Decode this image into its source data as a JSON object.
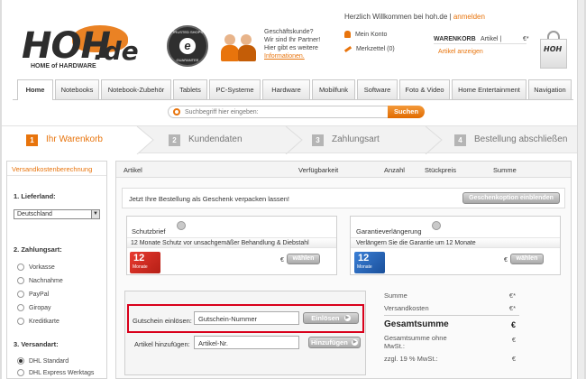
{
  "colors": {
    "accent": "#e8740c",
    "highlight_box": "#d9001b"
  },
  "header": {
    "welcome": "Herzlich Willkommen bei hoh.de |",
    "login": "anmelden",
    "logo_main": "HOH",
    "logo_domain": ".de",
    "logo_sub": "HOME of HARDWARE",
    "trust_seal": "TRUSTED SHOPS",
    "trust_guarantee": "GUARANTEE",
    "business": [
      "Geschäftskunde?",
      "Wir sind Ihr Partner!",
      "Hier gibt es weitere"
    ],
    "business_link": "Informationen.",
    "my_account": "Mein Konto",
    "watchlist": "Merkzettel (0)",
    "cart_label": "WARENKORB",
    "cart_items": "Artikel |",
    "cart_total": "€*",
    "cart_show": "Artikel anzeigen",
    "bag_logo": "HOH"
  },
  "nav": [
    "Home",
    "Notebooks",
    "Notebook-Zubehör",
    "Tablets",
    "PC-Systeme",
    "Hardware",
    "Mobilfunk",
    "Software",
    "Foto & Video",
    "Home Entertainment",
    "Navigation"
  ],
  "search": {
    "placeholder": "Suchbegriff hier eingeben:",
    "button": "Suchen"
  },
  "steps": [
    {
      "num": "1",
      "label": "Ihr Warenkorb"
    },
    {
      "num": "2",
      "label": "Kundendaten"
    },
    {
      "num": "3",
      "label": "Zahlungsart"
    },
    {
      "num": "4",
      "label": "Bestellung abschließen"
    }
  ],
  "sidebar": {
    "title": "Versandkostenberechnung",
    "s1": "1. Lieferland:",
    "country": "Deutschland",
    "s2": "2. Zahlungsart:",
    "payments": [
      "Vorkasse",
      "Nachnahme",
      "PayPal",
      "Giropay",
      "Kreditkarte"
    ],
    "s3": "3. Versandart:",
    "shipping": [
      "DHL Standard",
      "DHL Express Werktags"
    ]
  },
  "cart": {
    "headers": {
      "article": "Artikel",
      "availability": "Verfügbarkeit",
      "qty": "Anzahl",
      "unit_price": "Stückpreis",
      "sum": "Summe"
    },
    "gift_text": "Jetzt Ihre Bestellung als Geschenk verpacken lassen!",
    "gift_button": "Geschenkoption einblenden",
    "protect_title": "Schutzbrief",
    "protect_desc": "12 Monate Schutz vor unsachgemäßer Behandlung & Diebstahl",
    "protect_badge_num": "12",
    "protect_badge_text": "Monate",
    "protect_currency": "€",
    "protect_button": "wählen",
    "warranty_title": "Garantieverlängerung",
    "warranty_desc": "Verlängern Sie die Garantie um 12 Monate",
    "warranty_badge_num": "12",
    "warranty_badge_text": "Monate",
    "warranty_currency": "€",
    "warranty_button": "wählen",
    "voucher_label": "Gutschein einlösen:",
    "voucher_value": "Gutschein-Nummer",
    "voucher_button": "Einlösen",
    "add_label": "Artikel hinzufügen:",
    "add_value": "Artikel-Nr.",
    "add_button": "Hinzufügen"
  },
  "summary": {
    "sum_label": "Summe",
    "sum_val": "€*",
    "shipping_label": "Versandkosten",
    "shipping_val": "€*",
    "total_label": "Gesamtsumme",
    "total_val": "€",
    "net_label_1": "Gesamtsumme ohne",
    "net_label_2": "MwSt.:",
    "net_val": "€",
    "vat_label": "zzgl. 19 % MwSt.:",
    "vat_val": "€"
  }
}
